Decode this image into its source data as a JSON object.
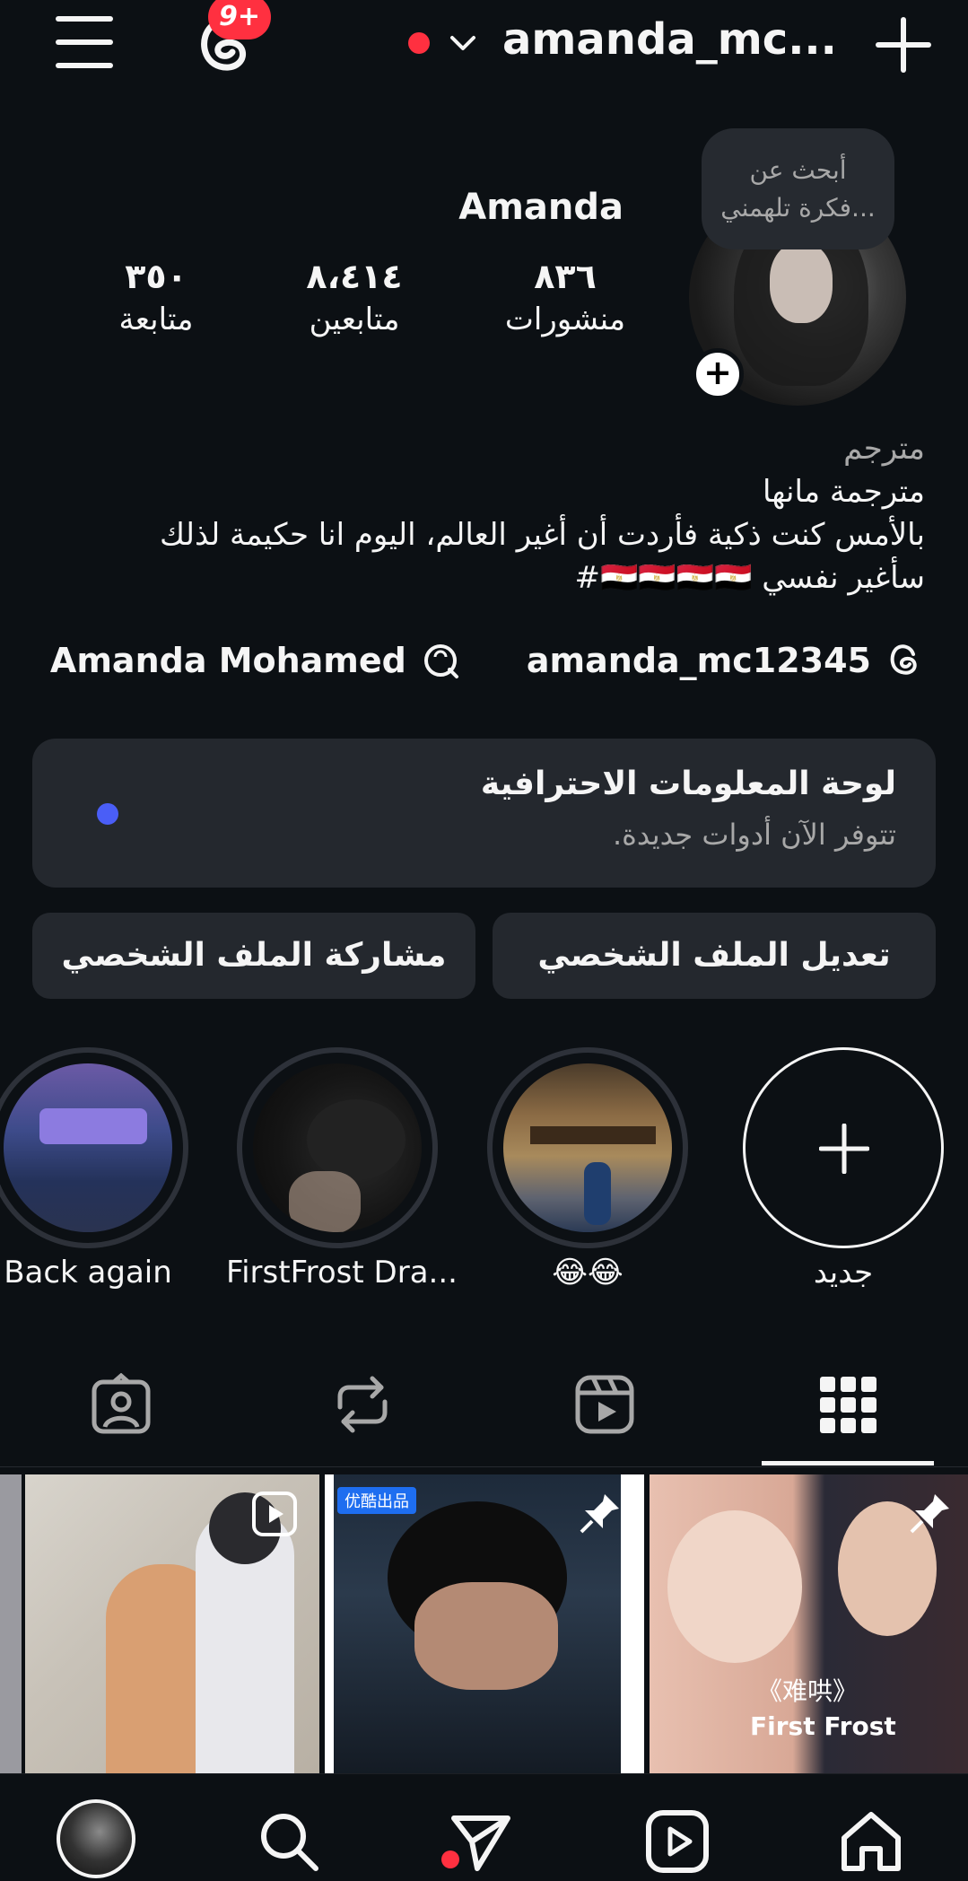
{
  "header": {
    "notification_badge": "9+",
    "username": "amanda_mc...",
    "status_color": "#ff3040"
  },
  "profile": {
    "note": [
      "أبحث عن",
      "فكرة تلهمني..."
    ],
    "display_name": "Amanda",
    "stats": [
      {
        "value": "٨٣٦",
        "label": "منشورات"
      },
      {
        "value": "٨،٤١٤",
        "label": "متابعين"
      },
      {
        "value": "٣٥٠",
        "label": "متابعة"
      }
    ],
    "category": "مترجم",
    "bio_lines": [
      "مترجمة مانها",
      "بالأمس كنت ذكية فأردت أن أغير العالم، اليوم انا حكيمة لذلك",
      "سأغير نفسي 🇪🇬🇪🇬🇪🇬🇪🇬#"
    ],
    "threads_handle": "amanda_mc12345",
    "linked_name": "Amanda Mohamed"
  },
  "dashboard": {
    "title": "لوحة المعلومات الاحترافية",
    "subtitle": "تتوفر الآن أدوات جديدة.",
    "dot_color": "#4a5ef7"
  },
  "buttons": {
    "edit_profile": "تعديل الملف الشخصي",
    "share_profile": "مشاركة الملف الشخصي"
  },
  "highlights": [
    {
      "label": "جديد"
    },
    {
      "label": "😂😂"
    },
    {
      "label": "FirstFrost Dra..."
    },
    {
      "label": "Back again"
    }
  ],
  "grid": {
    "post3_caption": "First Frost",
    "post3_title": "《难哄》",
    "post2_tag": "优酷出品"
  }
}
